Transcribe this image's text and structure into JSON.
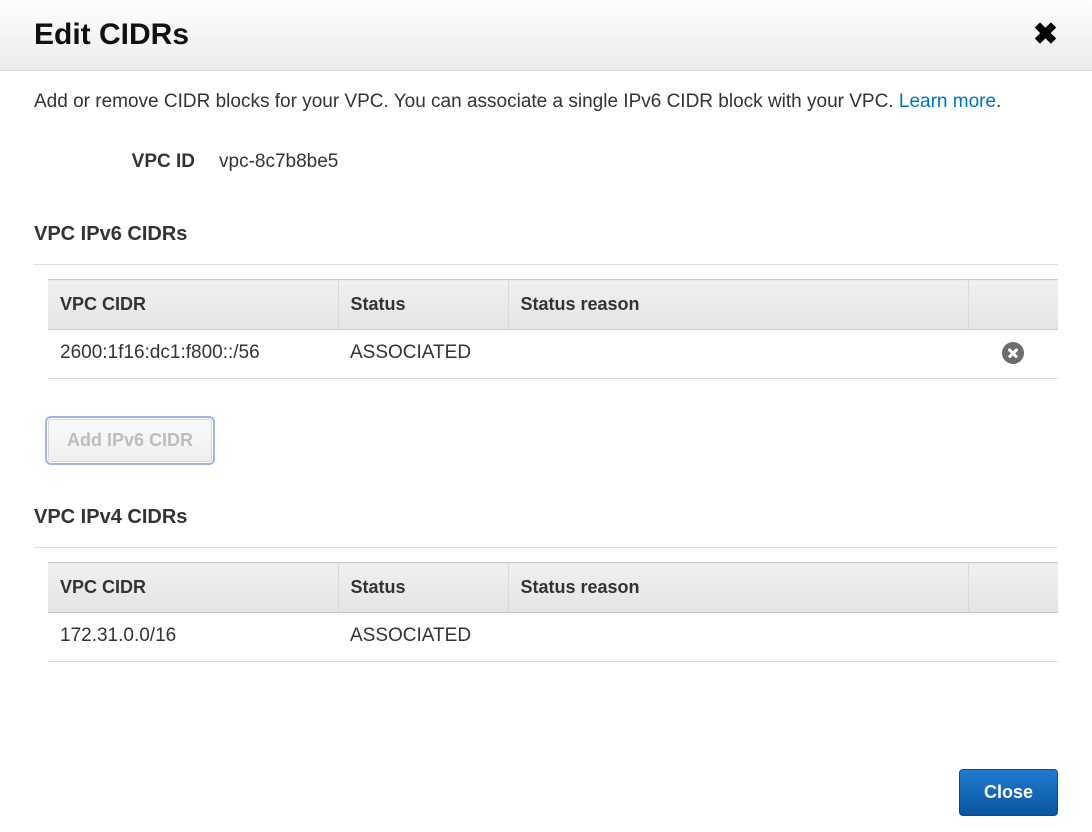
{
  "dialog": {
    "title": "Edit CIDRs",
    "description_prefix": "Add or remove CIDR blocks for your VPC. You can associate a single IPv6 CIDR block with your VPC. ",
    "learn_more": "Learn more",
    "period": "."
  },
  "vpc": {
    "id_label": "VPC ID",
    "id_value": "vpc-8c7b8be5"
  },
  "ipv6": {
    "section_title": "VPC IPv6 CIDRs",
    "headers": {
      "cidr": "VPC CIDR",
      "status": "Status",
      "reason": "Status reason"
    },
    "rows": [
      {
        "cidr": "2600:1f16:dc1:f800::/56",
        "status": "ASSOCIATED",
        "reason": ""
      }
    ],
    "add_button": "Add IPv6 CIDR"
  },
  "ipv4": {
    "section_title": "VPC IPv4 CIDRs",
    "headers": {
      "cidr": "VPC CIDR",
      "status": "Status",
      "reason": "Status reason"
    },
    "rows": [
      {
        "cidr": "172.31.0.0/16",
        "status": "ASSOCIATED",
        "reason": ""
      }
    ]
  },
  "footer": {
    "close": "Close"
  }
}
